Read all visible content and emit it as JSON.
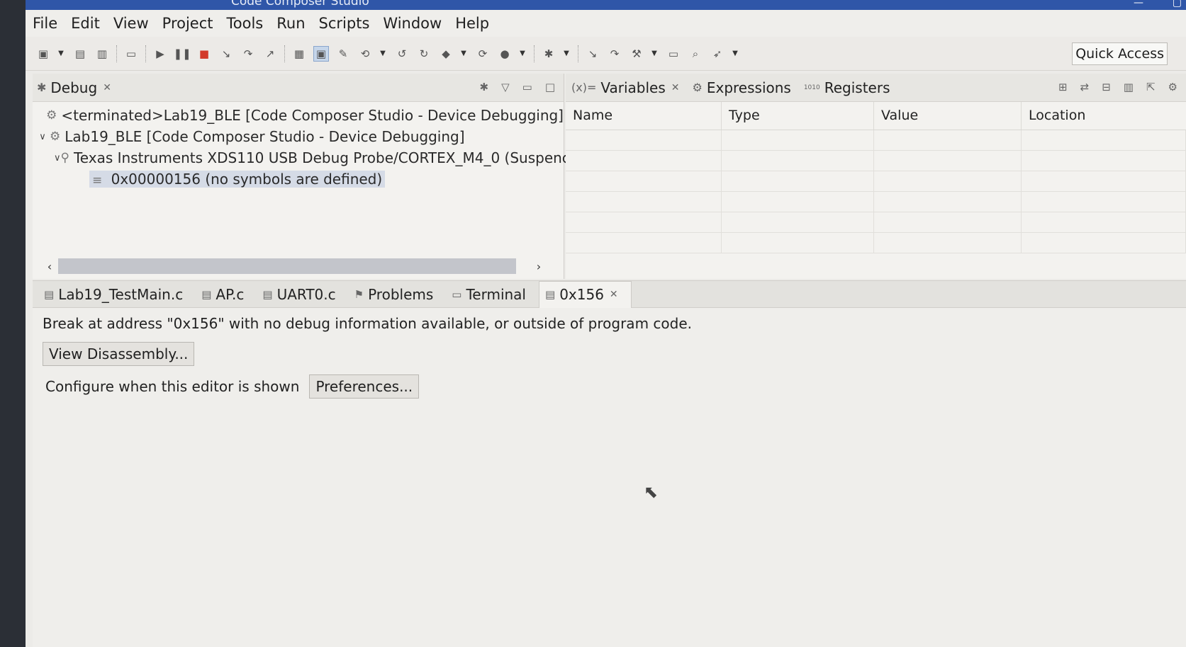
{
  "window": {
    "title": "Code Composer Studio"
  },
  "menu": [
    "File",
    "Edit",
    "View",
    "Project",
    "Tools",
    "Run",
    "Scripts",
    "Window",
    "Help"
  ],
  "toolbar": {
    "quick_access": "Quick Access"
  },
  "debug_view": {
    "tab_label": "Debug",
    "tree": [
      {
        "label": "<terminated>Lab19_BLE [Code Composer Studio - Device Debugging]"
      },
      {
        "label": "Lab19_BLE [Code Composer Studio - Device Debugging]"
      },
      {
        "label": "Texas Instruments XDS110 USB Debug Probe/CORTEX_M4_0 (Suspenc"
      },
      {
        "label": "0x00000156  (no symbols are defined)"
      }
    ]
  },
  "variables_view": {
    "tabs": [
      {
        "icon": "(x)=",
        "label": "Variables"
      },
      {
        "label": "Expressions"
      },
      {
        "icon": "1010",
        "label": "Registers"
      }
    ],
    "columns": [
      "Name",
      "Type",
      "Value",
      "Location"
    ]
  },
  "editor": {
    "tabs": [
      "Lab19_TestMain.c",
      "AP.c",
      "UART0.c",
      "Problems",
      "Terminal",
      "0x156"
    ],
    "message": "Break at address \"0x156\" with no debug information available, or outside of program code.",
    "view_disassembly_label": "View Disassembly...",
    "configure_label": "Configure when this editor is shown",
    "preferences_label": "Preferences..."
  }
}
